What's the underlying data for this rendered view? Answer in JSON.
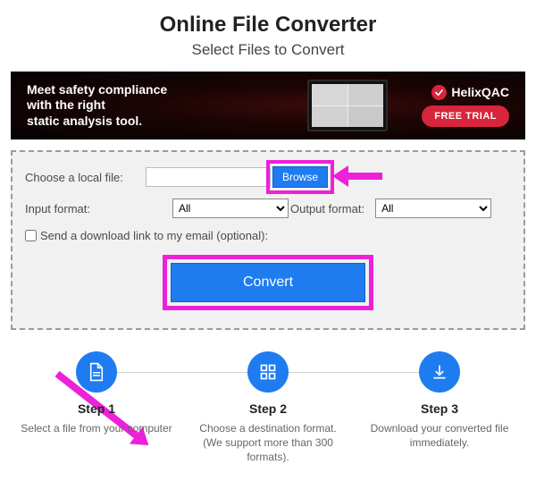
{
  "header": {
    "title": "Online File Converter",
    "subtitle": "Select Files to Convert"
  },
  "ad": {
    "line1": "Meet safety compliance",
    "line2": "with the right",
    "line3": "static analysis tool.",
    "brand": "HelixQAC",
    "cta": "FREE TRIAL"
  },
  "form": {
    "choose_label": "Choose a local file:",
    "browse_label": "Browse",
    "input_format_label": "Input format:",
    "output_format_label": "Output format:",
    "format_option_all": "All",
    "email_label": "Send a download link to my email (optional):",
    "convert_label": "Convert"
  },
  "steps": [
    {
      "title": "Step 1",
      "desc": "Select a file from your computer"
    },
    {
      "title": "Step 2",
      "desc": "Choose a destination format. (We support more than 300 formats)."
    },
    {
      "title": "Step 3",
      "desc": "Download your converted file immediately."
    }
  ]
}
